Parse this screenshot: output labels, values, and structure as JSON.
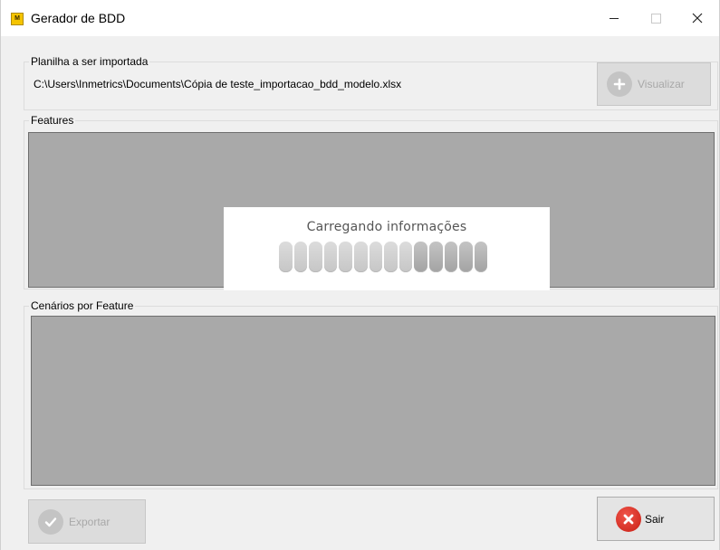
{
  "window": {
    "title": "Gerador de BDD",
    "icon": "app-logo-icon",
    "icon_text": "M",
    "controls": [
      "minimize-icon",
      "maximize-icon",
      "close-icon"
    ]
  },
  "planilha": {
    "legend": "Planilha a ser importada",
    "path": "C:\\Users\\Inmetrics\\Documents\\Cópia de teste_importacao_bdd_modelo.xlsx",
    "visualizar_label": "Visualizar",
    "visualizar_icon": "plus-icon"
  },
  "features": {
    "legend": "Features"
  },
  "cenarios": {
    "legend": "Cenários por Feature"
  },
  "loading": {
    "text": "Carregando informações",
    "total_bars": 14,
    "progress_bars": 9
  },
  "footer": {
    "exportar_label": "Exportar",
    "exportar_icon": "check-icon",
    "sair_label": "Sair",
    "sair_icon": "close-circle-icon"
  },
  "colors": {
    "accent_icon": "#f5c400",
    "grid_bg": "#a9a9a9",
    "exit_red": "#d9261c"
  }
}
